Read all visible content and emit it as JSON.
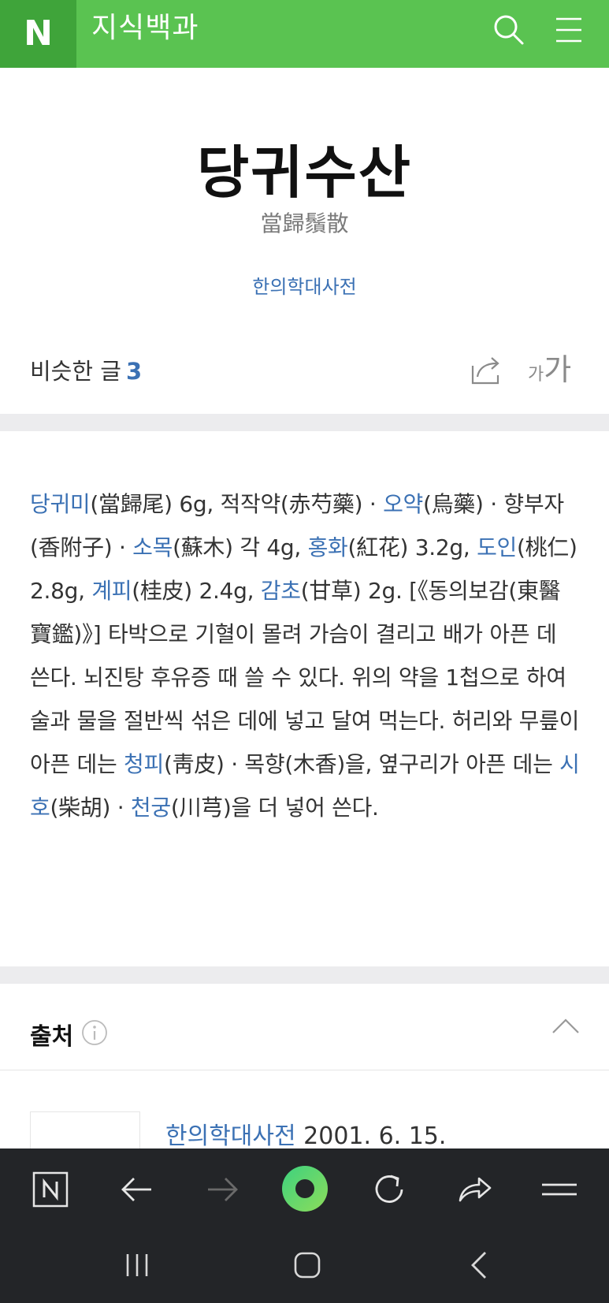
{
  "header": {
    "logo": "N",
    "title": "지식백과",
    "icons": [
      "search-icon",
      "menu-icon"
    ]
  },
  "article": {
    "title": "당귀수산",
    "hanja": "當歸鬚散",
    "source": "한의학대사전"
  },
  "similar": {
    "label": "비슷한 글",
    "count": "3",
    "font_small": "가",
    "font_large": "가"
  },
  "body": {
    "segments": [
      {
        "link": "당귀미",
        "text": "(當歸尾) 6g, 적작약(赤芍藥) · "
      },
      {
        "link": "오약",
        "text": "(烏藥) · 향부자(香附子) · "
      },
      {
        "link": "소목",
        "text": "(蘇木) 각 4g, "
      },
      {
        "link": "홍화",
        "text": "(紅花) 3.2g, "
      },
      {
        "link": "도인",
        "text": "(桃仁) 2.8g, "
      },
      {
        "link": "계피",
        "text": "(桂皮) 2.4g, "
      },
      {
        "link": "감초",
        "text": "(甘草) 2g. [《동의보감(東醫寶鑑)》] 타박으로 기혈이 몰려 가슴이 결리고 배가 아픈 데 쓴다. 뇌진탕 후유증 때 쓸 수 있다. 위의 약을 1첩으로 하여 술과 물을 절반씩 섞은 데에 넣고 달여 먹는다. 허리와 무릎이 아픈 데는 "
      },
      {
        "link": "청피",
        "text": "(靑皮) · 목향(木香)을, 옆구리가 아픈 데는 "
      },
      {
        "link": "시호",
        "text": "(柴胡) · "
      },
      {
        "link": "천궁",
        "text": "(川芎)을 더 넣어 쓴다."
      }
    ]
  },
  "source_section": {
    "title": "출처",
    "entry_link": "한의학대사전",
    "entry_date": " 2001. 6. 15."
  },
  "colors": {
    "brand": "#5ac351",
    "brand_dark": "#3fa43a",
    "link": "#3b71b4",
    "bar": "#232528",
    "center_button": "#5ad08a"
  },
  "browser_bar": {
    "icons": [
      "naver-n-icon",
      "back-arrow-icon",
      "forward-arrow-icon",
      "green-dot-icon",
      "refresh-icon",
      "share-icon",
      "menu-icon"
    ]
  },
  "system_bar": {
    "icons": [
      "recent-apps-icon",
      "home-icon",
      "back-icon"
    ]
  }
}
